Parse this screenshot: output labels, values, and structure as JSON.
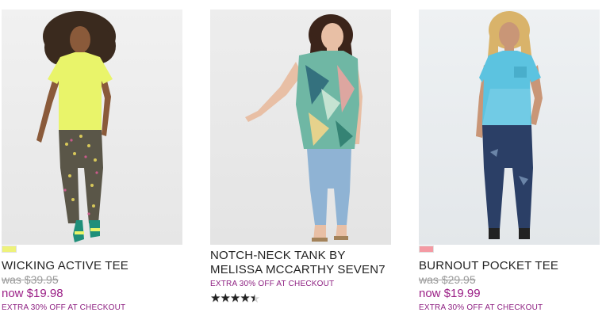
{
  "products": [
    {
      "name": "WICKING ACTIVE TEE",
      "swatch_colors": [
        "#eef27a"
      ],
      "was_price": "was $39.95",
      "now_price": "now $19.98",
      "promo": "EXTRA 30% OFF AT CHECKOUT",
      "image_icon": "model-photo-icon"
    },
    {
      "name": "NOTCH-NECK TANK BY MELISSA MCCARTHY SEVEN7",
      "promo": "EXTRA 30% OFF AT CHECKOUT",
      "rating": {
        "value": 4.5,
        "max": 5,
        "stars": "★★★★★"
      },
      "image_icon": "model-photo-icon"
    },
    {
      "name": "BURNOUT POCKET TEE",
      "swatch_colors": [
        "#f49aa3"
      ],
      "was_price": "was $29.95",
      "now_price": "now $19.99",
      "promo": "EXTRA 30% OFF AT CHECKOUT",
      "image_icon": "model-photo-icon"
    }
  ]
}
